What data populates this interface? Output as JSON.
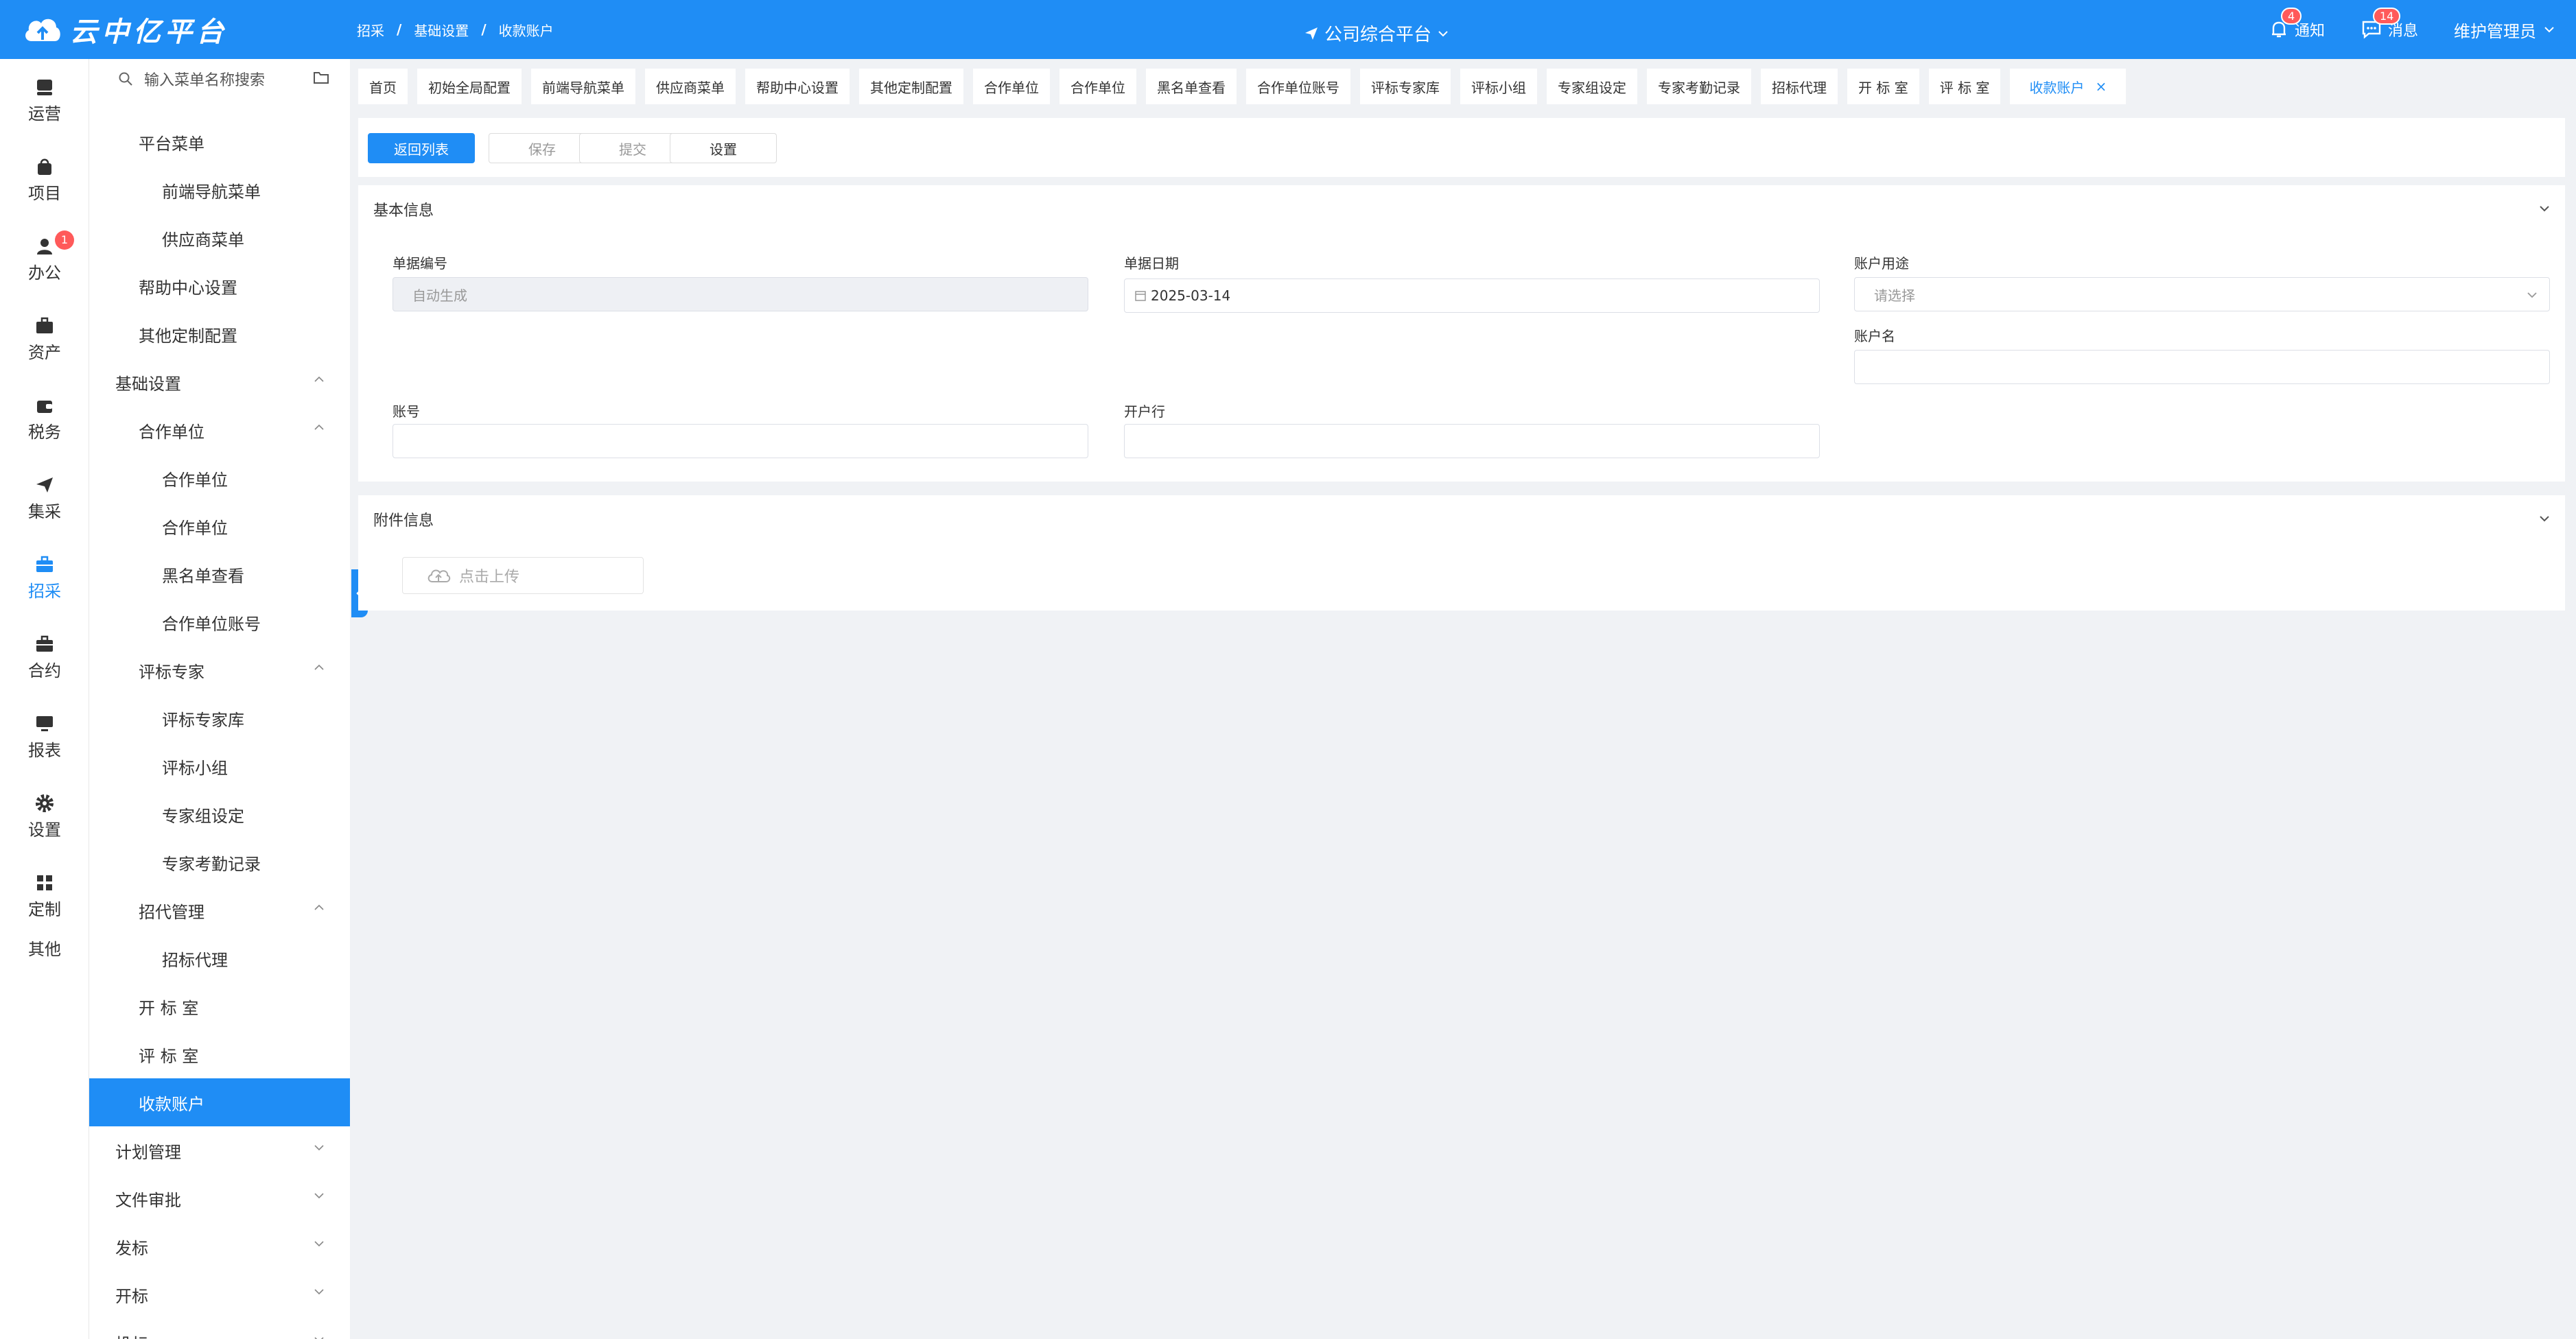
{
  "app": {
    "title": "云中亿平台"
  },
  "breadcrumb": [
    "招采",
    "基础设置",
    "收款账户"
  ],
  "platform": {
    "label": "公司综合平台"
  },
  "header": {
    "notify_label": "通知",
    "notify_count": "4",
    "message_label": "消息",
    "message_count": "14",
    "user_label": "维护管理员"
  },
  "rail": {
    "items": [
      {
        "label": "运营",
        "icon": "server-icon"
      },
      {
        "label": "项目",
        "icon": "bag-icon"
      },
      {
        "label": "办公",
        "icon": "person-icon",
        "badge": "1"
      },
      {
        "label": "资产",
        "icon": "briefcase-icon"
      },
      {
        "label": "税务",
        "icon": "wallet-icon"
      },
      {
        "label": "集采",
        "icon": "paper-plane-icon"
      },
      {
        "label": "招采",
        "icon": "toolbox-icon",
        "active": true
      },
      {
        "label": "合约",
        "icon": "briefcase-icon"
      },
      {
        "label": "报表",
        "icon": "monitor-icon"
      },
      {
        "label": "设置",
        "icon": "gear-icon"
      },
      {
        "label": "定制",
        "icon": "grid-icon"
      },
      {
        "label": "其他"
      }
    ]
  },
  "sidebar": {
    "search_placeholder": "输入菜单名称搜索",
    "items": [
      {
        "label": "平台菜单",
        "level": 2
      },
      {
        "label": "前端导航菜单",
        "level": 3
      },
      {
        "label": "供应商菜单",
        "level": 3
      },
      {
        "label": "帮助中心设置",
        "level": 2
      },
      {
        "label": "其他定制配置",
        "level": 2
      },
      {
        "label": "基础设置",
        "level": 1,
        "expanded": true
      },
      {
        "label": "合作单位",
        "level": 2,
        "expanded": true
      },
      {
        "label": "合作单位",
        "level": 3
      },
      {
        "label": "合作单位",
        "level": 3
      },
      {
        "label": "黑名单查看",
        "level": 3
      },
      {
        "label": "合作单位账号",
        "level": 3
      },
      {
        "label": "评标专家",
        "level": 2,
        "expanded": true
      },
      {
        "label": "评标专家库",
        "level": 3
      },
      {
        "label": "评标小组",
        "level": 3
      },
      {
        "label": "专家组设定",
        "level": 3
      },
      {
        "label": "专家考勤记录",
        "level": 3
      },
      {
        "label": "招代管理",
        "level": 2,
        "expanded": true
      },
      {
        "label": "招标代理",
        "level": 3
      },
      {
        "label": "开 标 室",
        "level": 2
      },
      {
        "label": "评 标 室",
        "level": 2
      },
      {
        "label": "收款账户",
        "level": 2,
        "active": true
      },
      {
        "label": "计划管理",
        "level": 1,
        "collapsed": true
      },
      {
        "label": "文件审批",
        "level": 1,
        "collapsed": true
      },
      {
        "label": "发标",
        "level": 1,
        "collapsed": true
      },
      {
        "label": "开标",
        "level": 1,
        "collapsed": true
      },
      {
        "label": "投标",
        "level": 1,
        "collapsed": true
      }
    ]
  },
  "tabs": [
    "首页",
    "初始全局配置",
    "前端导航菜单",
    "供应商菜单",
    "帮助中心设置",
    "其他定制配置",
    "合作单位",
    "合作单位",
    "黑名单查看",
    "合作单位账号",
    "评标专家库",
    "评标小组",
    "专家组设定",
    "专家考勤记录",
    "招标代理",
    "开 标 室",
    "评 标 室"
  ],
  "active_tab": {
    "label": "收款账户",
    "close": "×"
  },
  "toolbar": {
    "back": "返回列表",
    "save": "保存",
    "submit": "提交",
    "settings": "设置"
  },
  "basic": {
    "title": "基本信息",
    "doc_no_label": "单据编号",
    "doc_no_value": "自动生成",
    "doc_date_label": "单据日期",
    "doc_date_value": "2025-03-14",
    "purpose_label": "账户用途",
    "purpose_placeholder": "请选择",
    "account_name_label": "账户名",
    "account_name_value": "",
    "account_no_label": "账号",
    "account_no_value": "",
    "bank_label": "开户行",
    "bank_value": ""
  },
  "attachments": {
    "title": "附件信息",
    "upload_label": "点击上传"
  },
  "colors": {
    "primary": "#1f8df5",
    "badge": "#ff5a5a",
    "background": "#f0f2f5"
  }
}
